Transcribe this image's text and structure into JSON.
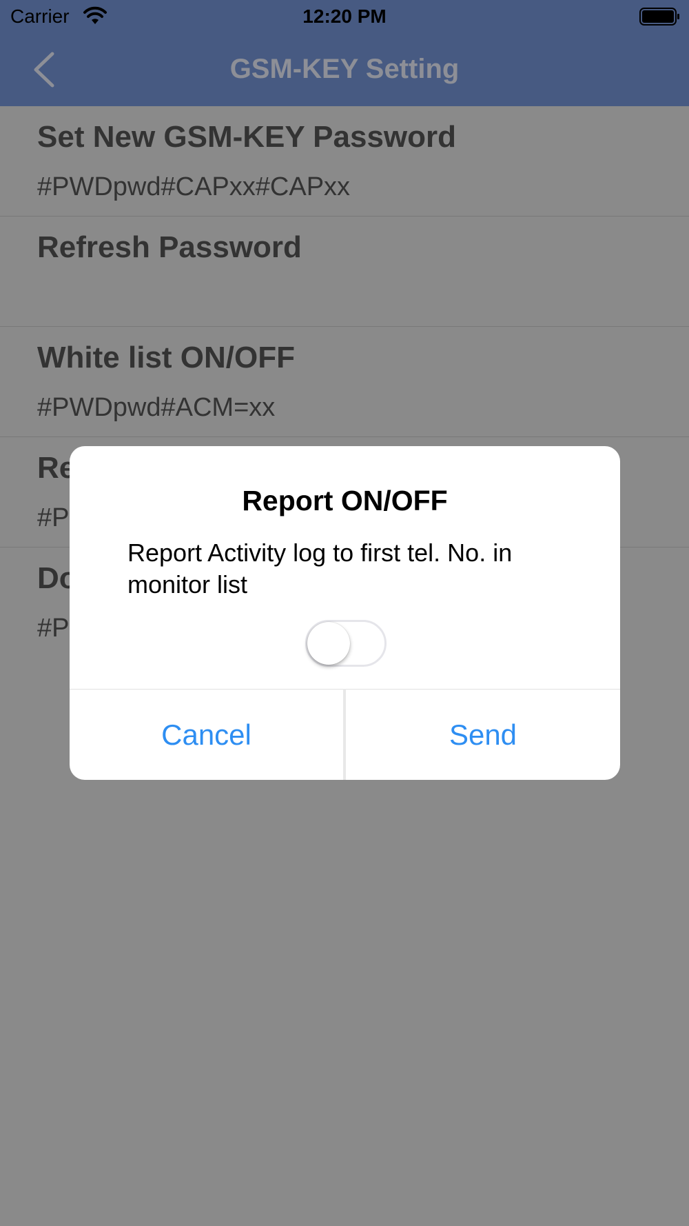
{
  "status_bar": {
    "carrier": "Carrier",
    "time": "12:20 PM",
    "wifi_icon": "wifi-icon",
    "battery_icon": "battery-full-icon"
  },
  "nav": {
    "title": "GSM-KEY Setting",
    "back_icon": "chevron-left-icon"
  },
  "settings": [
    {
      "title": "Set New GSM-KEY Password",
      "command": "#PWDpwd#CAPxx#CAPxx"
    },
    {
      "title": "Refresh Password",
      "command": ""
    },
    {
      "title": "White list ON/OFF",
      "command": "#PWDpwd#ACM=xx"
    },
    {
      "title": "Re",
      "command": "#P"
    },
    {
      "title": "Do",
      "command": "#P"
    }
  ],
  "dialog": {
    "title": "Report ON/OFF",
    "message": "Report Activity log to first tel. No. in monitor list",
    "toggle_on": false,
    "cancel_label": "Cancel",
    "send_label": "Send"
  },
  "colors": {
    "nav_background": "#475a82",
    "overlay": "#8a8a8a",
    "button_text": "#2e8ef2"
  }
}
